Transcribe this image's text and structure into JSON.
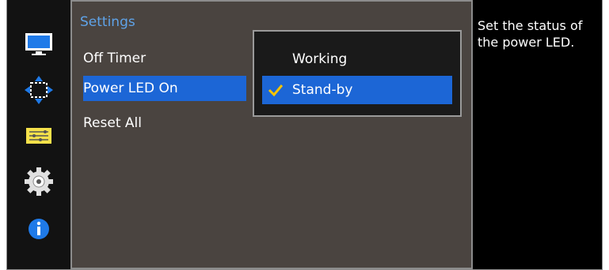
{
  "sidebar": {
    "icons": [
      "picture-icon",
      "position-icon",
      "adjust-sliders-icon",
      "gear-icon",
      "info-icon"
    ],
    "accent": "#1c66d6"
  },
  "settings": {
    "title": "Settings",
    "items": [
      {
        "label": "Off Timer",
        "selected": false
      },
      {
        "label": "Power LED On",
        "selected": true
      },
      {
        "label": "Reset All",
        "selected": false
      }
    ]
  },
  "dropdown": {
    "options": [
      {
        "label": "Working",
        "selected": false
      },
      {
        "label": "Stand-by",
        "selected": true
      }
    ],
    "check_color": "#f5c400"
  },
  "description": {
    "text": "Set the status of the power LED."
  }
}
